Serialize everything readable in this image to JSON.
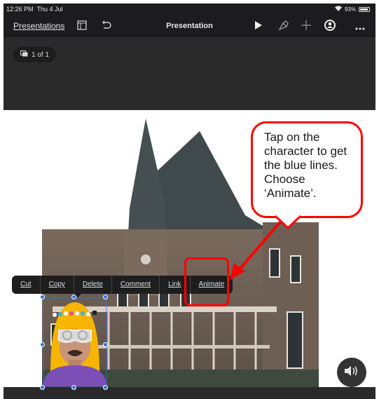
{
  "status_bar": {
    "time": "12:26 PM",
    "date": "Thu 4 Jul",
    "battery": "93%",
    "battery_level": 0.93
  },
  "toolbar": {
    "back_label": "Presentations",
    "title": "Presentation",
    "icons": [
      "sidebar-icon",
      "undo-icon",
      "play-icon",
      "paintbrush-icon",
      "plus-icon",
      "collaborate-icon",
      "more-icon"
    ]
  },
  "slide_counter": {
    "label": "1 of 1"
  },
  "callout": {
    "text": "Tap on the character to get the blue lines. Choose ‘Animate’.",
    "color": "#ff0000"
  },
  "context_menu": {
    "items": [
      "Cut",
      "Copy",
      "Delete",
      "Comment",
      "Link",
      "Animate"
    ]
  },
  "colors": {
    "selection": "#2e72e0",
    "highlight": "#ff0000",
    "toolbar_bg": "#1c1c1e"
  }
}
